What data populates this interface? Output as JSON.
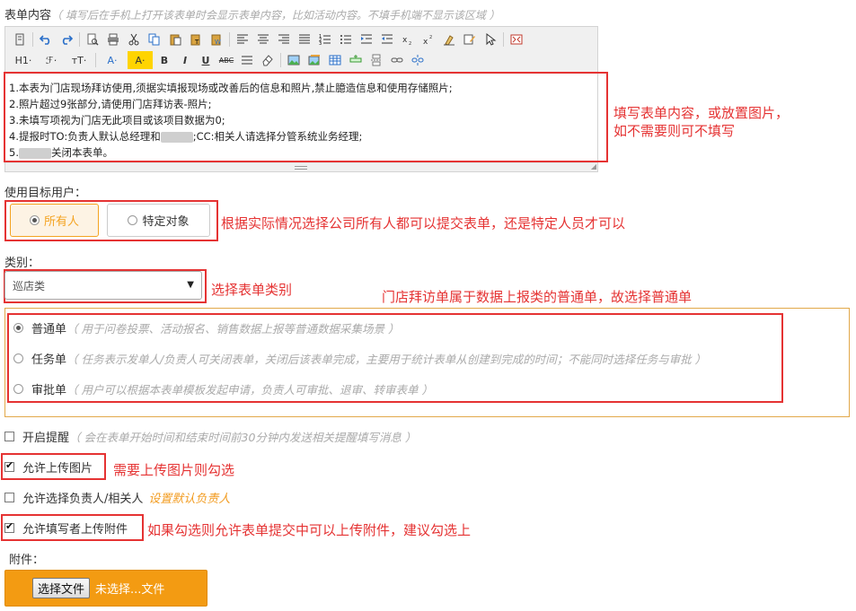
{
  "form_content": {
    "label": "表单内容",
    "hint": "（ 填写后在手机上打开该表单时会显示表单内容，比如活动内容。不填手机端不显示该区域 ）",
    "toolbar_row2": {
      "heading": "H1·",
      "font_family": "ℱ·",
      "font_size": "тT·",
      "font_color": "A·",
      "highlight": "A·",
      "bold": "B",
      "italic": "I",
      "underline": "U",
      "strike": "ABC"
    },
    "lines": [
      "1.本表为门店现场拜访使用,须据实填报现场或改善后的信息和照片,禁止臆造信息和使用存储照片;",
      "2.照片超过9张部分,请使用门店拜访表-照片;",
      "3.未填写项视为门店无此项目或该项目数据为0;",
      "4.提报时TO:负责人默认总经理和",
      ";CC:相关人请选择分管系统业务经理;",
      "关闭本表单。"
    ],
    "line5_prefix": "5."
  },
  "annotations": {
    "content": "填写表单内容，或放置图片，",
    "content2": "如不需要则可不填写",
    "target": "根据实际情况选择公司所有人都可以提交表单，还是特定人员才可以",
    "category": "选择表单类别",
    "type": "门店拜访单属于数据上报类的普通单，故选择普通单",
    "upload_image": "需要上传图片则勾选",
    "upload_attachment": "如果勾选则允许表单提交中可以上传附件，建议勾选上"
  },
  "target_users": {
    "label": "使用目标用户：",
    "options": [
      "所有人",
      "特定对象"
    ],
    "selected": "所有人"
  },
  "category": {
    "label": "类别：",
    "value": "巡店类"
  },
  "form_types": [
    {
      "name": "普通单",
      "desc": "（ 用于问卷投票、活动报名、销售数据上报等普通数据采集场景 ）",
      "selected": true
    },
    {
      "name": "任务单",
      "desc": "（ 任务表示发单人/负责人可关闭表单，关闭后该表单完成，主要用于统计表单从创建到完成的时间；不能同时选择任务与审批 ）",
      "selected": false
    },
    {
      "name": "审批单",
      "desc": "（ 用户可以根据本表单模板发起申请，负责人可审批、退审、转审表单 ）",
      "selected": false
    }
  ],
  "options": {
    "reminder": {
      "label": "开启提醒",
      "hint": "（ 会在表单开始时间和结束时间前30分钟内发送相关提醒填写消息 ）",
      "checked": false
    },
    "upload_image": {
      "label": "允许上传图片",
      "checked": true
    },
    "choose_owner": {
      "label": "允许选择负责人/相关人",
      "link": "设置默认负责人",
      "checked": false
    },
    "upload_attachment": {
      "label": "允许填写者上传附件",
      "checked": true
    }
  },
  "attachment": {
    "label": "附件：",
    "button": "选择文件",
    "status": "未选择...文件"
  },
  "colors": {
    "accent": "#f39b12",
    "annotation_red": "#e53333",
    "selected_bg": "#fdf3e4"
  }
}
